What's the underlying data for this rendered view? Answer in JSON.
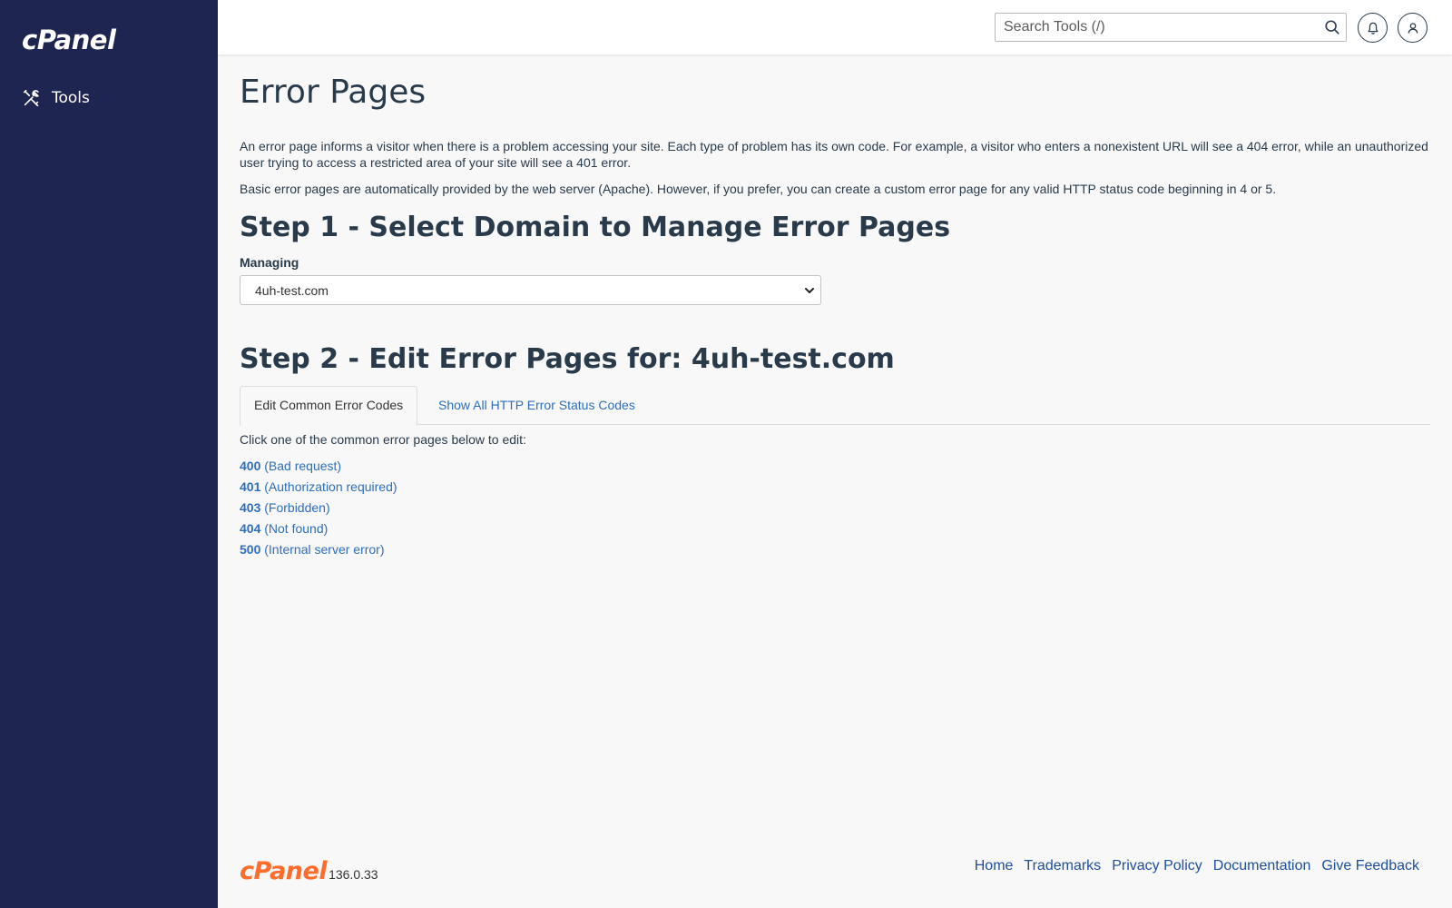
{
  "sidebar": {
    "logo": "cPanel",
    "items": [
      {
        "label": "Tools",
        "icon": "tools-icon"
      }
    ]
  },
  "header": {
    "search_placeholder": "Search Tools (/)",
    "search_icon": "search-icon",
    "notifications_icon": "bell-icon",
    "user_icon": "user-icon"
  },
  "main": {
    "title": "Error Pages",
    "intro_1": "An error page informs a visitor when there is a problem accessing your site. Each type of problem has its own code. For example, a visitor who enters a nonexistent URL will see a 404 error, while an unauthorized user trying to access a restricted area of your site will see a 401 error.",
    "intro_2": "Basic error pages are automatically provided by the web server (Apache). However, if you prefer, you can create a custom error page for any valid HTTP status code beginning in 4 or 5.",
    "step1_heading": "Step 1 - Select Domain to Manage Error Pages",
    "managing_label": "Managing",
    "selected_domain": "4uh-test.com",
    "step2_heading": "Step 2 - Edit Error Pages for: 4uh-test.com",
    "tabs": [
      {
        "label": "Edit Common Error Codes",
        "active": true
      },
      {
        "label": "Show All HTTP Error Status Codes",
        "active": false
      }
    ],
    "click_note": "Click one of the common error pages below to edit:",
    "error_codes": [
      {
        "code": "400",
        "desc": "(Bad request)"
      },
      {
        "code": "401",
        "desc": "(Authorization required)"
      },
      {
        "code": "403",
        "desc": "(Forbidden)"
      },
      {
        "code": "404",
        "desc": "(Not found)"
      },
      {
        "code": "500",
        "desc": "(Internal server error)"
      }
    ]
  },
  "footer": {
    "logo": "cPanel",
    "version": "136.0.33",
    "links": [
      "Home",
      "Trademarks",
      "Privacy Policy",
      "Documentation",
      "Give Feedback"
    ]
  },
  "colors": {
    "sidebar_bg": "#1f2551",
    "link": "#2e6ebd",
    "brand_orange": "#ff6c2c",
    "text": "#293a4a"
  }
}
